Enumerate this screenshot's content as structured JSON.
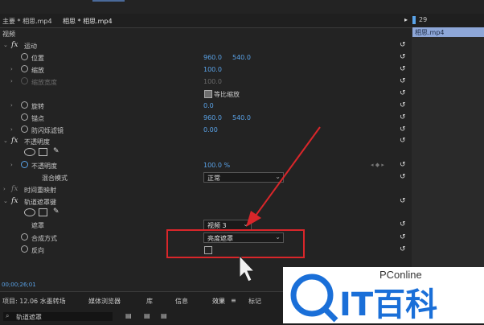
{
  "tabs": {
    "master": "主要 * 相思.mp4",
    "clip": "相思 * 相思.mp4"
  },
  "timeline": {
    "timecode": "29",
    "clip_name": "相思.mp4"
  },
  "section": "视频",
  "motion": {
    "name": "运动",
    "position_label": "位置",
    "position_x": "960.0",
    "position_y": "540.0",
    "scale_label": "缩放",
    "scale_value": "100.0",
    "scale_width_label": "缩放宽度",
    "scale_width_value": "100.0",
    "uniform_label": "等比缩放",
    "rotation_label": "旋转",
    "rotation_value": "0.0",
    "anchor_label": "锚点",
    "anchor_x": "960.0",
    "anchor_y": "540.0",
    "flicker_label": "防闪烁滤镜",
    "flicker_value": "0.00"
  },
  "opacity": {
    "name": "不透明度",
    "value_label": "不透明度",
    "value": "100.0 %",
    "blend_label": "混合模式",
    "blend_value": "正常"
  },
  "time_remap": "时间重映射",
  "track_matte": {
    "name": "轨道遮罩键",
    "matte_label": "遮罩",
    "matte_value": "视频 3",
    "composite_label": "合成方式",
    "composite_value": "亮度遮罩",
    "reverse_label": "反向"
  },
  "status_timecode": "00;00;26;01",
  "bottom": {
    "project": "项目: 12.06 水墨转场",
    "media_browser": "媒体浏览器",
    "library": "库",
    "info": "信息",
    "effects": "效果",
    "markers": "标记",
    "search_value": "轨道遮罩"
  },
  "watermark": {
    "brand": "PConline",
    "text": "IT百科"
  },
  "icons": [
    "fx-icon",
    "stopwatch-icon",
    "reset-icon",
    "ellipse-mask-icon",
    "rect-mask-icon",
    "pen-mask-icon",
    "search-icon",
    "folder-icon",
    "play-icon"
  ],
  "colors": {
    "value_blue": "#5aa3e8",
    "highlight_red": "#d9262a",
    "clip_blue": "#8ea7d8",
    "logo_blue": "#1a6fd8"
  }
}
